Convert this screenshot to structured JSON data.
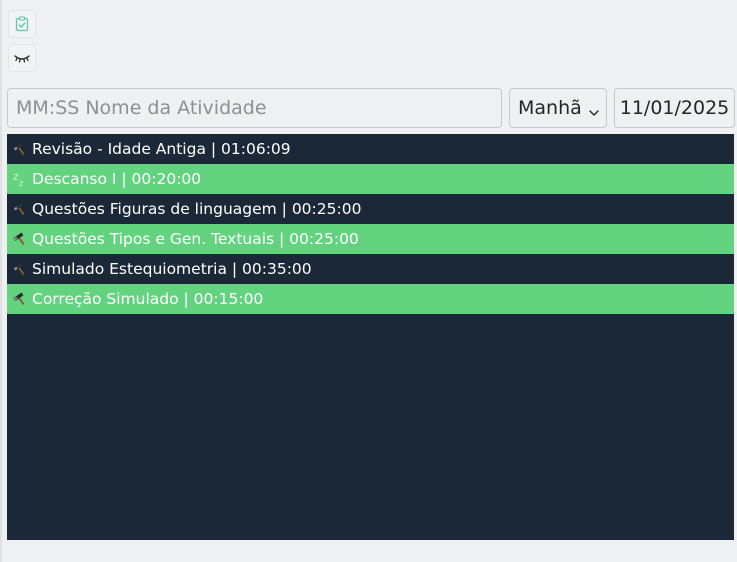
{
  "toolbar": {
    "checklist_icon": "clipboard-check-icon",
    "sleep_icon": "closed-eye-icon"
  },
  "entry": {
    "activity_placeholder": "MM:SS Nome da Atividade",
    "activity_value": "",
    "period_value": "Manhã",
    "date_value": "11/01/2025"
  },
  "activities": [
    {
      "icon": "hammer-icon",
      "label": "Revisão - Idade Antiga | 01:06:09",
      "highlighted": false
    },
    {
      "icon": "sleep-zz-icon",
      "label": "Descanso I | 00:20:00",
      "highlighted": true
    },
    {
      "icon": "hammer-icon",
      "label": "Questões Figuras de linguagem | 00:25:00",
      "highlighted": false
    },
    {
      "icon": "hammer-icon",
      "label": "Questões Tipos e Gen. Textuais | 00:25:00",
      "highlighted": true
    },
    {
      "icon": "hammer-icon",
      "label": "Simulado Estequiometria | 00:35:00",
      "highlighted": false
    },
    {
      "icon": "hammer-icon",
      "label": "Correção Simulado | 00:15:00",
      "highlighted": true
    }
  ],
  "colors": {
    "panel_bg": "#1b2838",
    "highlight_bg": "#63d37f",
    "row_text": "#ffffff",
    "window_bg": "#eff0f1"
  }
}
